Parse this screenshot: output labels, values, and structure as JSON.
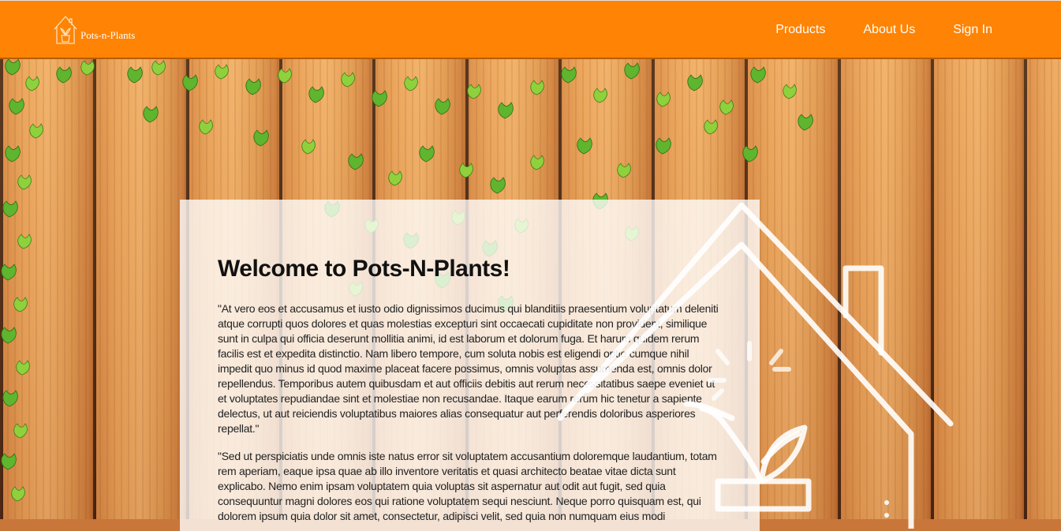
{
  "brand": {
    "name": "Pots-n-Plants",
    "icon": "house-plant-icon"
  },
  "nav": {
    "products": "Products",
    "about": "About Us",
    "signin": "Sign In"
  },
  "colors": {
    "header": "#ff8304",
    "header_text": "#ffffff",
    "card": "rgba(255,255,255,0.78)"
  },
  "hero": {
    "title": "Welcome to Pots-N-Plants!",
    "paragraph1": "\"At vero eos et accusamus et iusto odio dignissimos ducimus qui blanditiis praesentium voluptatum deleniti atque corrupti quos dolores et quas molestias excepturi sint occaecati cupiditate non provident, similique sunt in culpa qui officia deserunt mollitia animi, id est laborum et dolorum fuga. Et harum quidem rerum facilis est et expedita distinctio. Nam libero tempore, cum soluta nobis est eligendi optio cumque nihil impedit quo minus id quod maxime placeat facere possimus, omnis voluptas assumenda est, omnis dolor repellendus. Temporibus autem quibusdam et aut officiis debitis aut rerum necessitatibus saepe eveniet ut et voluptates repudiandae sint et molestiae non recusandae. Itaque earum rerum hic tenetur a sapiente delectus, ut aut reiciendis voluptatibus maiores alias consequatur aut perferendis doloribus asperiores repellat.\"",
    "paragraph2": "\"Sed ut perspiciatis unde omnis iste natus error sit voluptatem accusantium doloremque laudantium, totam rem aperiam, eaque ipsa quae ab illo inventore veritatis et quasi architecto beatae vitae dicta sunt explicabo. Nemo enim ipsam voluptatem quia voluptas sit aspernatur aut odit aut fugit, sed quia consequuntur magni dolores eos qui ratione voluptatem sequi nesciunt. Neque porro quisquam est, qui dolorem ipsum quia dolor sit amet, consectetur, adipisci velit, sed quia non numquam eius modi"
  },
  "decor": {
    "background": "wood-fence-ivy-image",
    "watermark": "house-plant-outline-icon"
  }
}
